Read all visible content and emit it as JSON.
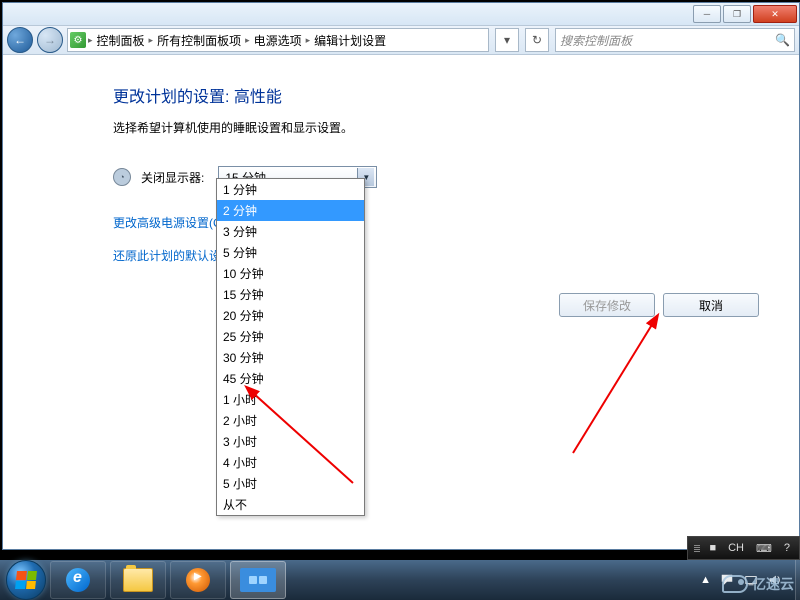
{
  "breadcrumb": [
    "控制面板",
    "所有控制面板项",
    "电源选项",
    "编辑计划设置"
  ],
  "search_placeholder": "搜索控制面板",
  "page": {
    "title": "更改计划的设置: 高性能",
    "subtitle": "选择希望计算机使用的睡眠设置和显示设置。",
    "display_off_label": "关闭显示器:",
    "display_off_value": "15 分钟",
    "adv_link": "更改高级电源设置(C",
    "restore_link": "还原此计划的默认设"
  },
  "dropdown_options": [
    "1 分钟",
    "2 分钟",
    "3 分钟",
    "5 分钟",
    "10 分钟",
    "15 分钟",
    "20 分钟",
    "25 分钟",
    "30 分钟",
    "45 分钟",
    "1 小时",
    "2 小时",
    "3 小时",
    "4 小时",
    "5 小时",
    "从不"
  ],
  "dropdown_selected_index": 1,
  "buttons": {
    "save": "保存修改",
    "cancel": "取消"
  },
  "window_controls": {
    "min": "─",
    "max": "❐",
    "close": "✕"
  },
  "language_bar": {
    "ime": "■",
    "lang": "CH",
    "kbd": "⌨",
    "help": "?"
  },
  "tray": {
    "up": "▲"
  },
  "watermark": "亿速云"
}
